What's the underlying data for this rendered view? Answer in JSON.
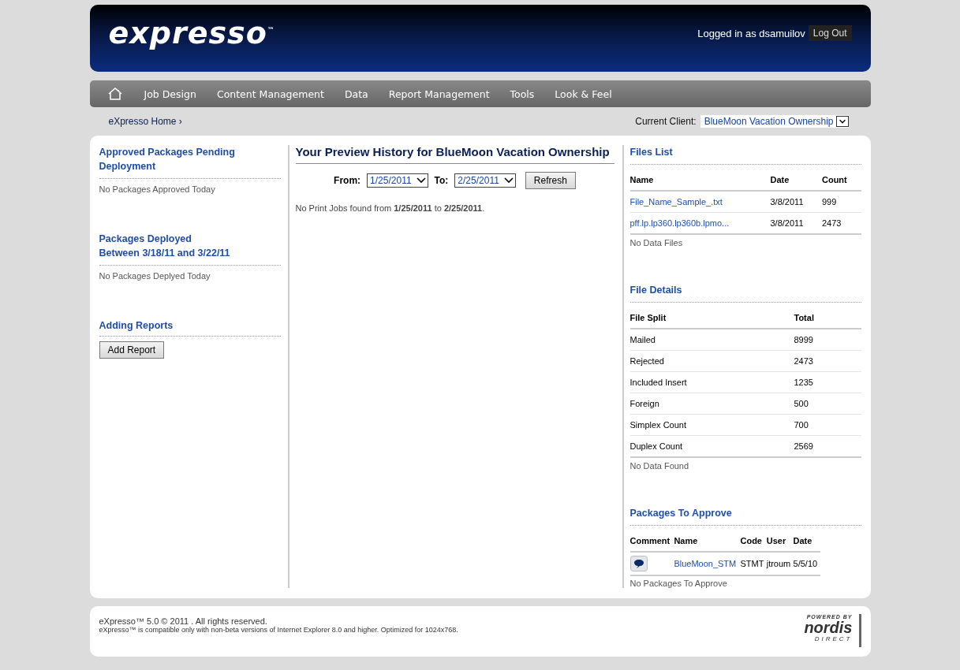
{
  "header": {
    "logo": "expresso",
    "logo_mark": "™",
    "user_text": "Logged in as dsamuilov",
    "logout": "Log Out"
  },
  "nav": {
    "items": [
      {
        "label": "Job Design"
      },
      {
        "label": "Content Management"
      },
      {
        "label": "Data"
      },
      {
        "label": "Report Management"
      },
      {
        "label": "Tools"
      },
      {
        "label": "Look & Feel"
      }
    ]
  },
  "breadcrumb": "eXpresso Home ›",
  "client": {
    "label": "Current Client:",
    "value": "BlueMoon Vacation Ownership"
  },
  "left": [
    {
      "title": [
        "Approved Packages Pending",
        "Deployment"
      ],
      "text": "No Packages Approved Today"
    },
    {
      "title": [
        "Packages Deployed",
        "Between 3/18/11 and 3/22/11"
      ],
      "text": "No Packages Deplyed Today"
    },
    {
      "title": [
        "Adding Reports"
      ],
      "button": "Add Report"
    }
  ],
  "preview": {
    "title": "Your Preview History for BlueMoon Vacation Ownership",
    "from_label": "From:",
    "from": "1/25/2011",
    "to_label": "To:",
    "to": "2/25/2011",
    "refresh": "Refresh",
    "message": "No Print Jobs found from **1/25/2011** to **2/25/2011**."
  },
  "files_list": {
    "title": "Files List",
    "columns": [
      "Name",
      "Date",
      "Count"
    ],
    "rows": [
      {
        "name": "File_Name_Sample_.txt",
        "date": "3/8/2011",
        "count": "999"
      },
      {
        "name": "pff.lp.lp360.lp360b.lpmo...",
        "date": "3/8/2011",
        "count": "2473"
      }
    ],
    "empty": "No Data Files"
  },
  "file_details": {
    "title": "File Details",
    "columns": [
      "File Split",
      "Total"
    ],
    "rows": [
      {
        "split": "Mailed",
        "total": "8999"
      },
      {
        "split": "Rejected",
        "total": "2473"
      },
      {
        "split": "Included Insert",
        "total": "1235"
      },
      {
        "split": "Foreign",
        "total": "500"
      },
      {
        "split": "Simplex Count",
        "total": "700"
      },
      {
        "split": "Duplex Count",
        "total": "2569"
      }
    ],
    "empty": "No Data Found"
  },
  "packages": {
    "title": "Packages To Approve",
    "columns": [
      "Comment",
      "Name",
      "Code",
      "User",
      "Date"
    ],
    "rows": [
      {
        "name": "BlueMoon_STM",
        "code": "STMT",
        "user": "jtroum",
        "date": "5/5/10"
      }
    ],
    "empty": "No Packages To Approve"
  },
  "footer": {
    "line1": "eXpresso™ 5.0 © 2011 . All rights reserved.",
    "line2": "eXpresso™ is compatible only with non-beta versions of Internet Explorer 8.0 and higher. Optimized for 1024x768.",
    "powered": "POWERED BY",
    "brand": "nordis",
    "brand_sub": "DIRECT"
  }
}
